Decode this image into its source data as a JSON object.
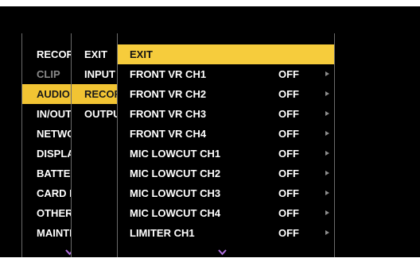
{
  "menu_level1": {
    "items": [
      {
        "label": "RECORDING SETUP",
        "state": "normal"
      },
      {
        "label": "CLIP",
        "state": "disabled"
      },
      {
        "label": "AUDIO SETUP",
        "state": "selected"
      },
      {
        "label": "IN/OUT SELECT",
        "state": "normal"
      },
      {
        "label": "NETWORK SETUP",
        "state": "normal"
      },
      {
        "label": "DISPLAY SETUP",
        "state": "normal"
      },
      {
        "label": "BATTERY SETUP",
        "state": "normal"
      },
      {
        "label": "CARD FUNCTIONS",
        "state": "normal"
      },
      {
        "label": "OTHER FUNCTIONS",
        "state": "normal"
      },
      {
        "label": "MAINTENANCE",
        "state": "normal"
      }
    ],
    "more_icon": "chevron-down-icon"
  },
  "menu_level2": {
    "items": [
      {
        "label": "EXIT",
        "state": "normal"
      },
      {
        "label": "INPUT SETTINGS",
        "state": "normal"
      },
      {
        "label": "RECORDING SETTINGS",
        "state": "selected"
      },
      {
        "label": "OUTPUT SETTINGS",
        "state": "normal"
      }
    ]
  },
  "menu_level3": {
    "items": [
      {
        "label": "EXIT",
        "value": "",
        "has_submenu": false,
        "state": "highlighted"
      },
      {
        "label": "FRONT VR CH1",
        "value": "OFF",
        "has_submenu": true
      },
      {
        "label": "FRONT VR CH2",
        "value": "OFF",
        "has_submenu": true
      },
      {
        "label": "FRONT VR CH3",
        "value": "OFF",
        "has_submenu": true
      },
      {
        "label": "FRONT VR CH4",
        "value": "OFF",
        "has_submenu": true
      },
      {
        "label": "MIC LOWCUT CH1",
        "value": "OFF",
        "has_submenu": true
      },
      {
        "label": "MIC LOWCUT CH2",
        "value": "OFF",
        "has_submenu": true
      },
      {
        "label": "MIC LOWCUT CH3",
        "value": "OFF",
        "has_submenu": true
      },
      {
        "label": "MIC LOWCUT CH4",
        "value": "OFF",
        "has_submenu": true
      },
      {
        "label": "LIMITER CH1",
        "value": "OFF",
        "has_submenu": true
      }
    ],
    "more_icon": "chevron-down-icon"
  },
  "colors": {
    "screen_bg": "#000000",
    "selected_bg": "#f2c433",
    "text": "#ffffff",
    "disabled_text": "#8a8a8a",
    "chevron": "#b070e0"
  }
}
